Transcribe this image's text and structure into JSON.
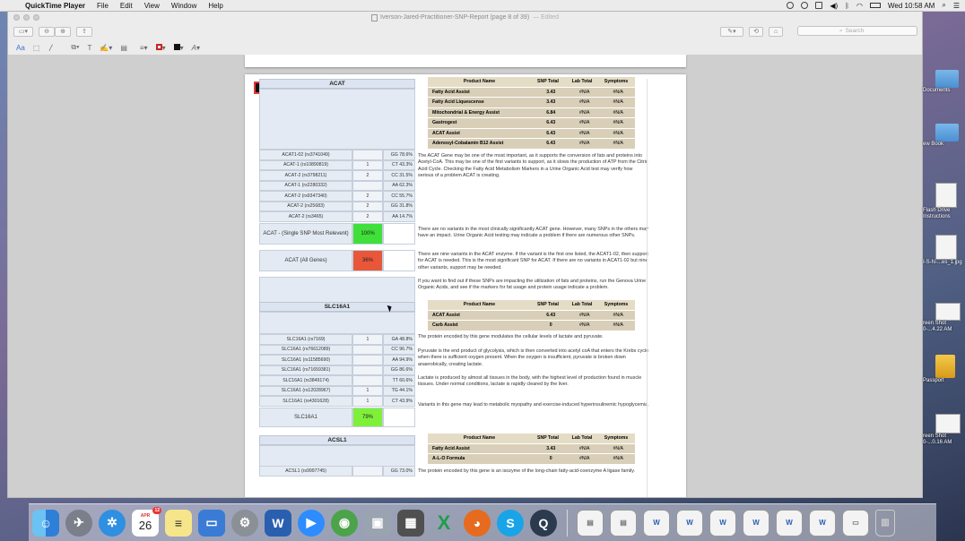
{
  "menubar": {
    "app_name": "QuickTime Player",
    "menus": [
      "File",
      "Edit",
      "View",
      "Window",
      "Help"
    ],
    "clock": "Wed 10:58 AM"
  },
  "window": {
    "title": "Iverson-Jared-Practitioner-SNP-Report (page 8 of 39)",
    "edited": "— Edited",
    "search_placeholder": "Search"
  },
  "sections": [
    {
      "gene": "ACAT",
      "snps": [
        {
          "name": "ACAT1-02 (rs3741049)",
          "count": "",
          "genotype": "GG 78.6%"
        },
        {
          "name": "ACAT-1 (rs10890819)",
          "count": "1",
          "genotype": "CT 43.3%"
        },
        {
          "name": "ACAT-2 (rs3798211)",
          "count": "2",
          "genotype": "CC 31.5%"
        },
        {
          "name": "ACAT-1 (rs2280332)",
          "count": "",
          "genotype": "AA 62.3%"
        },
        {
          "name": "ACAT-2 (rs9347340)",
          "count": "2",
          "genotype": "CC 55.7%"
        },
        {
          "name": "ACAT-2 (rs25683)",
          "count": "2",
          "genotype": "GG 31.8%"
        },
        {
          "name": "ACAT-2 (rs3465)",
          "count": "2",
          "genotype": "AA 14.7%"
        }
      ],
      "summaries": [
        {
          "label": "ACAT - (Single SNP Most Relevent)",
          "percent": "100%",
          "color": "#3fe03a"
        },
        {
          "label": "ACAT (All Genes)",
          "percent": "36%",
          "color": "#e8573a"
        }
      ],
      "products": {
        "headers": [
          "Product Name",
          "SNP Total",
          "Lab Total",
          "Symptoms"
        ],
        "rows": [
          [
            "Fatty Acid Assist",
            "3.43",
            "#N/A",
            "#N/A"
          ],
          [
            "Fatty Acid Liquescense",
            "3.43",
            "#N/A",
            "#N/A"
          ],
          [
            "Mitochondrial & Energy Assist",
            "6.84",
            "#N/A",
            "#N/A"
          ],
          [
            "Gastrogest",
            "6.43",
            "#N/A",
            "#N/A"
          ],
          [
            "ACAT Assist",
            "6.43",
            "#N/A",
            "#N/A"
          ],
          [
            "Adenosyl-Cobalamin B12 Assist",
            "6.43",
            "#N/A",
            "#N/A"
          ]
        ]
      },
      "descriptions": [
        "The ACAT Gene may be one of the most important, as it supports the conversion of fats and proteins into Acetyl-CoA. This may be one of the first variants to support, as it slows the production of ATP from the Citric Acid Cycle. Checking the Fatty Acid Metabolism Markers in a Urine Organic Acid test may verify how serious of a problem ACAT is creating.",
        "There are no variants in the most clinically significantly ACAT gene. However, many SNPs in the others may have an impact.  Urine Organic Acid testing may indicate a problem if there are numerous other SNPs.",
        "There are nine variants in the ACAT enzyme. If the variant is the first one listed, the ACAT1-02, then support for ACAT is needed. This is the most significant SNP for ACAT. If there are no variants in ACAT1-02 but nine other variants, support may be needed.",
        "If you want to find out if these SNPs are impacting the utilization of fats and proteins, run the Genova Urine Organic Acids, and see if the markers for fat usage and protein usage indicate a problem."
      ]
    },
    {
      "gene": "SLC16A1",
      "snps": [
        {
          "name": "SLC16A1 (rs7169)",
          "count": "1",
          "genotype": "GA 48.8%"
        },
        {
          "name": "SLC16A1 (rs76612089)",
          "count": "",
          "genotype": "CC 96.7%"
        },
        {
          "name": "SLC16A1 (rs11585690)",
          "count": "",
          "genotype": "AA 94.9%"
        },
        {
          "name": "SLC16A1 (rs71659381)",
          "count": "",
          "genotype": "GG 86.6%"
        },
        {
          "name": "SLC16A1 (rs3849174)",
          "count": "",
          "genotype": "TT 60.6%"
        },
        {
          "name": "SLC16A1 (rs12028967)",
          "count": "1",
          "genotype": "TG 44.1%"
        },
        {
          "name": "SLC16A1 (rs4301628)",
          "count": "1",
          "genotype": "CT 43.9%"
        }
      ],
      "summaries": [
        {
          "label": "SLC16A1",
          "percent": "79%",
          "color": "#7ef03a"
        }
      ],
      "products": {
        "headers": [
          "Product Name",
          "SNP Total",
          "Lab Total",
          "Symptoms"
        ],
        "rows": [
          [
            "ACAT Assist",
            "6.43",
            "#N/A",
            "#N/A"
          ],
          [
            "Carb Assist",
            "0",
            "#N/A",
            "#N/A"
          ]
        ]
      },
      "descriptions": [
        "The protein encoded by this gene modulates the cellular levels of lactate and pyruvate.",
        "Pyruvate is the end product of glycolysis, which is then converted into acetyl coA that enters the Krebs cycle when there is sufficient oxygen present. When the oxygen is insufficient, pyruvate is broken down anaerobically, creating lactate.",
        "Lactate is produced by almost all tissues in the body, with the highest level of production found in muscle tissues. Under normal conditions, lactate is rapidly cleared by the liver.",
        "Variants in this gene may lead to metabolic myopathy and exercise-induced hyperinsulinemic hypoglycemia."
      ]
    },
    {
      "gene": "ACSL1",
      "snps": [
        {
          "name": "ACSL1 (rs9997745)",
          "count": "",
          "genotype": "GG 73.0%"
        }
      ],
      "products": {
        "headers": [
          "Product Name",
          "SNP Total",
          "Lab Total",
          "Symptoms"
        ],
        "rows": [
          [
            "Fatty Acid Assist",
            "3.43",
            "#N/A",
            "#N/A"
          ],
          [
            "A-L-O Formula",
            "0",
            "#N/A",
            "#N/A"
          ]
        ]
      },
      "descriptions": [
        "The protein encoded by this gene is an isozyme of the long-chain fatty-acid-coenzyme A ligase family."
      ]
    }
  ],
  "desktop_items": [
    {
      "label": "Documents"
    },
    {
      "label": "ew Book"
    },
    {
      "label": "Flash Drive Instructions"
    },
    {
      "label": "I-S-N-...es_1.jpg"
    },
    {
      "label": "reen Shot 0-...4.22 AM"
    },
    {
      "label": "Passport"
    },
    {
      "label": "reen Shot 0-...0.16 AM"
    }
  ],
  "dock": {
    "calendar_month": "APR",
    "calendar_day": "26",
    "calendar_badge": "12"
  }
}
